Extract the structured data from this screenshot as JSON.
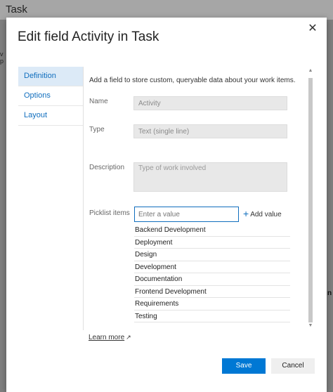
{
  "background": {
    "title": "Task",
    "left_hint": "v p",
    "right_hint": "n"
  },
  "dialog": {
    "title": "Edit field Activity in Task",
    "close_glyph": "✕"
  },
  "nav": {
    "items": [
      {
        "label": "Definition",
        "active": true
      },
      {
        "label": "Options",
        "active": false
      },
      {
        "label": "Layout",
        "active": false
      }
    ]
  },
  "definition": {
    "description_text": "Add a field to store custom, queryable data about your work items.",
    "name_label": "Name",
    "name_value": "Activity",
    "type_label": "Type",
    "type_value": "Text (single line)",
    "description_label": "Description",
    "description_placeholder": "Type of work involved",
    "picklist_label": "Picklist items",
    "picklist_placeholder": "Enter a value",
    "add_value_label": "Add value",
    "picklist_items": [
      "Backend Development",
      "Deployment",
      "Design",
      "Development",
      "Documentation",
      "Frontend Development",
      "Requirements",
      "Testing"
    ]
  },
  "footer": {
    "learn_more": "Learn more",
    "save_label": "Save",
    "cancel_label": "Cancel"
  },
  "colors": {
    "accent": "#0078d4",
    "nav_active_bg": "#dceaf7",
    "overlay": "#7f7f7f"
  }
}
